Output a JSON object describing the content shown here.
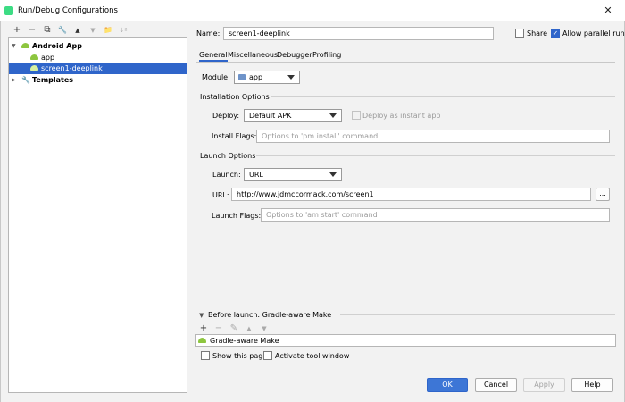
{
  "window": {
    "title": "Run/Debug Configurations",
    "close_glyph": "✕"
  },
  "left_toolbar": {
    "add": "+",
    "remove": "−",
    "copy": "⧉",
    "wrench": "🔧",
    "up": "▲",
    "down": "▼",
    "folder": "📁",
    "sort": "↓ª"
  },
  "tree": {
    "items": [
      {
        "label": "Android App",
        "level": 0,
        "expanded": true,
        "selected": false
      },
      {
        "label": "app",
        "level": 1,
        "selected": false
      },
      {
        "label": "screen1-deeplink",
        "level": 1,
        "selected": true
      },
      {
        "label": "Templates",
        "level": 0,
        "expanded": false,
        "selected": false
      }
    ]
  },
  "header": {
    "name_label": "Name:",
    "name_value": "screen1-deeplink",
    "share_label": "Share",
    "share_checked": false,
    "parallel_label": "Allow parallel run",
    "parallel_checked": true
  },
  "tabs": [
    {
      "label": "General",
      "active": true
    },
    {
      "label": "Miscellaneous",
      "active": false
    },
    {
      "label": "Debugger",
      "active": false
    },
    {
      "label": "Profiling",
      "active": false
    }
  ],
  "module": {
    "label": "Module:",
    "value": "app"
  },
  "installation": {
    "section": "Installation Options",
    "deploy_label": "Deploy:",
    "deploy_value": "Default APK",
    "instant_label": "Deploy as instant app",
    "flags_label": "Install Flags:",
    "flags_placeholder": "Options to 'pm install' command"
  },
  "launch": {
    "section": "Launch Options",
    "launch_label": "Launch:",
    "launch_value": "URL",
    "url_label": "URL:",
    "url_value": "http://www.jdmccormack.com/screen1",
    "browse_label": "...",
    "flags_label": "Launch Flags:",
    "flags_placeholder": "Options to 'am start' command"
  },
  "before_launch": {
    "section": "Before launch: Gradle-aware Make",
    "tools": {
      "add": "+",
      "remove": "−",
      "edit": "✎",
      "up": "▲",
      "down": "▼"
    },
    "task": "Gradle-aware Make",
    "show_page_label": "Show this page",
    "activate_label": "Activate tool window"
  },
  "buttons": {
    "ok": "OK",
    "cancel": "Cancel",
    "apply": "Apply",
    "help": "Help"
  },
  "colors": {
    "accent": "#2f65ca",
    "android_green": "#8dc63f"
  }
}
